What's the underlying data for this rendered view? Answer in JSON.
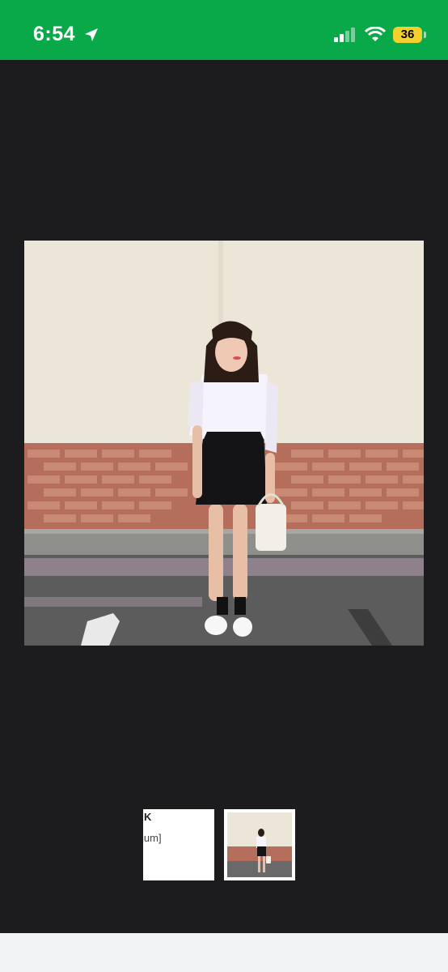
{
  "status_bar": {
    "time": "6:54",
    "battery": "36",
    "icons": [
      "location-arrow-icon",
      "cellular-signal-icon",
      "wifi-icon",
      "battery-icon"
    ],
    "background_color": "#09a94a",
    "battery_color": "#f4d02c"
  },
  "viewer": {
    "background_color": "#1c1c1e",
    "thumbnails": [
      {
        "text_line_1": "K",
        "text_line_2": "ium]"
      },
      {
        "text_line_1": "",
        "text_line_2": ""
      }
    ]
  }
}
